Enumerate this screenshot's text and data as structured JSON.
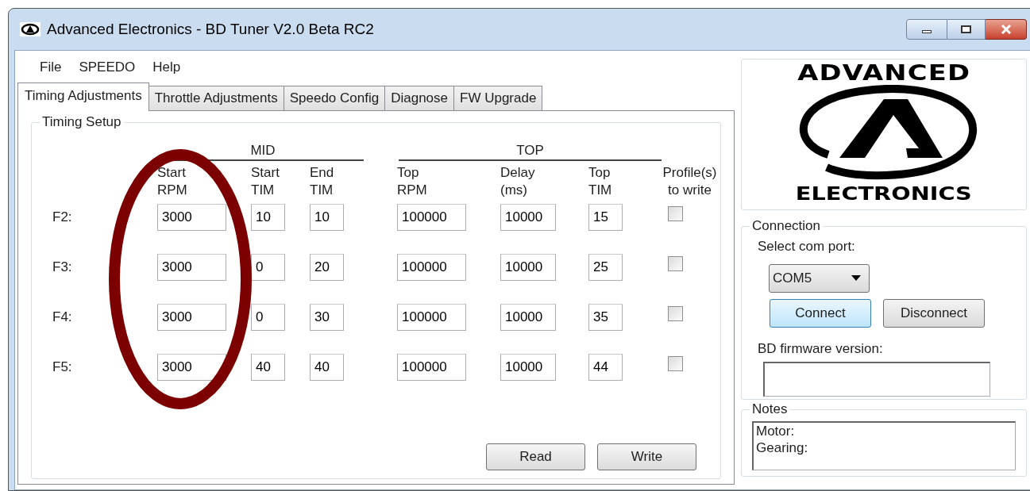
{
  "window": {
    "title": "Advanced Electronics - BD Tuner V2.0 Beta RC2"
  },
  "menu": [
    "File",
    "SPEEDO",
    "Help"
  ],
  "tabs": [
    {
      "label": "Timing Adjustments",
      "selected": true
    },
    {
      "label": "Throttle Adjustments",
      "selected": false
    },
    {
      "label": "Speedo Config",
      "selected": false
    },
    {
      "label": "Diagnose",
      "selected": false
    },
    {
      "label": "FW Upgrade",
      "selected": false
    }
  ],
  "timing_setup": {
    "title": "Timing Setup",
    "groups": [
      {
        "label": "MID"
      },
      {
        "label": "TOP"
      }
    ],
    "columns": [
      [
        "Start",
        "RPM"
      ],
      [
        "Start",
        "TIM"
      ],
      [
        "End",
        "TIM"
      ],
      [
        "Top",
        "RPM"
      ],
      [
        "Delay",
        "(ms)"
      ],
      [
        "Top",
        "TIM"
      ],
      [
        "Profile(s)",
        "to write"
      ]
    ],
    "rows": [
      {
        "label": "F2:",
        "values": [
          "3000",
          "10",
          "10",
          "100000",
          "10000",
          "15"
        ],
        "checked": false
      },
      {
        "label": "F3:",
        "values": [
          "3000",
          "0",
          "20",
          "100000",
          "10000",
          "25"
        ],
        "checked": false
      },
      {
        "label": "F4:",
        "values": [
          "3000",
          "0",
          "30",
          "100000",
          "10000",
          "35"
        ],
        "checked": false
      },
      {
        "label": "F5:",
        "values": [
          "3000",
          "40",
          "40",
          "100000",
          "10000",
          "44"
        ],
        "checked": false
      }
    ],
    "buttons": [
      "Read",
      "Write"
    ]
  },
  "logo": {
    "top": "ADVANCED",
    "bottom": "ELECTRONICS"
  },
  "connection": {
    "title": "Connection",
    "port_label": "Select com port:",
    "port": "COM5",
    "buttons": [
      {
        "label": "Connect",
        "focused": true
      },
      {
        "label": "Disconnect",
        "focused": false
      }
    ],
    "firmware_label": "BD firmware version:"
  },
  "notes": {
    "title": "Notes",
    "lines": [
      "Motor:",
      "Gearing:"
    ]
  }
}
